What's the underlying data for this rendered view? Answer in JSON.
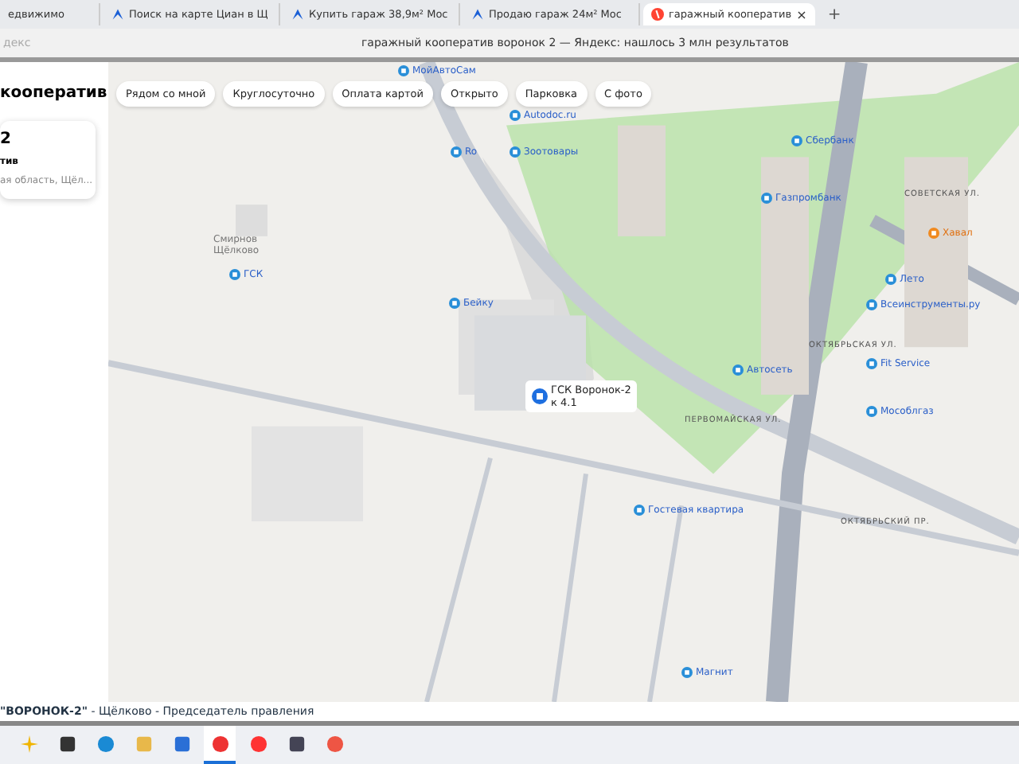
{
  "tabs": [
    {
      "label": "едвижимо",
      "selected": false,
      "kind": "plain"
    },
    {
      "label": "Поиск на карте Циан в Щ",
      "selected": false,
      "kind": "cian"
    },
    {
      "label": "Купить гараж 38,9м² Мос",
      "selected": false,
      "kind": "cian"
    },
    {
      "label": "Продаю гараж 24м² Мос",
      "selected": false,
      "kind": "cian"
    },
    {
      "label": "гаражный кооператив",
      "selected": true,
      "kind": "yandex"
    }
  ],
  "new_tab": "+",
  "close_tab": "×",
  "address_bar": {
    "left": "декс",
    "title": "гаражный кооператив воронок 2 — Яндекс: нашлось 3 млн результатов"
  },
  "sidebar": {
    "heading": "кооператив",
    "result": {
      "name": "2",
      "category": "тив",
      "address": "ая область, Щёл..."
    }
  },
  "filters": [
    "Рядом со мной",
    "Круглосуточно",
    "Оплата картой",
    "Открыто",
    "Парковка",
    "С фото"
  ],
  "map": {
    "places": [
      {
        "label": "МойАвтоСам",
        "kind": "poi"
      },
      {
        "label": "Autodoc.ru",
        "kind": "poi"
      },
      {
        "label": "Сбербанк",
        "kind": "poi"
      },
      {
        "label": "Ro",
        "kind": "poi"
      },
      {
        "label": "Зоотовары",
        "kind": "poi"
      },
      {
        "label": "СОВЕТСКАЯ УЛ.",
        "kind": "street"
      },
      {
        "label": "Газпромбанк",
        "kind": "poi"
      },
      {
        "label": "Хавал",
        "kind": "shop"
      },
      {
        "label": "Смирнов\nЩёлково",
        "kind": "area"
      },
      {
        "label": "ГСК",
        "kind": "poi"
      },
      {
        "label": "Лето",
        "kind": "poi"
      },
      {
        "label": "Бейку",
        "kind": "poi"
      },
      {
        "label": "Всеинструменты.ру",
        "kind": "poi"
      },
      {
        "label": "ОКТЯБРЬСКАЯ УЛ.",
        "kind": "street"
      },
      {
        "label": "Fit Service",
        "kind": "poi"
      },
      {
        "label": "Автосеть",
        "kind": "poi"
      },
      {
        "label": "ГСК Воронок-2\nк 4.1",
        "kind": "main"
      },
      {
        "label": "Мособлгаз",
        "kind": "poi"
      },
      {
        "label": "ПЕРВОМАЙСКАЯ УЛ.",
        "kind": "street"
      },
      {
        "label": "Гостевая квартира",
        "kind": "poi"
      },
      {
        "label": "ОКТЯБРЬСКИЙ ПР.",
        "kind": "street"
      },
      {
        "label": "Магнит",
        "kind": "poi"
      }
    ]
  },
  "bottom_strip": {
    "name": "\"ВОРОНОК-2\"",
    "rest": " - Щёлково - Председатель правления"
  },
  "taskbar": [
    {
      "kind": "sparkle",
      "active": false
    },
    {
      "kind": "taskview",
      "active": false
    },
    {
      "kind": "edge",
      "active": false
    },
    {
      "kind": "folder",
      "active": false
    },
    {
      "kind": "mail",
      "active": false
    },
    {
      "kind": "ybrowser",
      "active": true
    },
    {
      "kind": "yandex",
      "active": false
    },
    {
      "kind": "calc",
      "active": false
    },
    {
      "kind": "pin",
      "active": false
    }
  ]
}
